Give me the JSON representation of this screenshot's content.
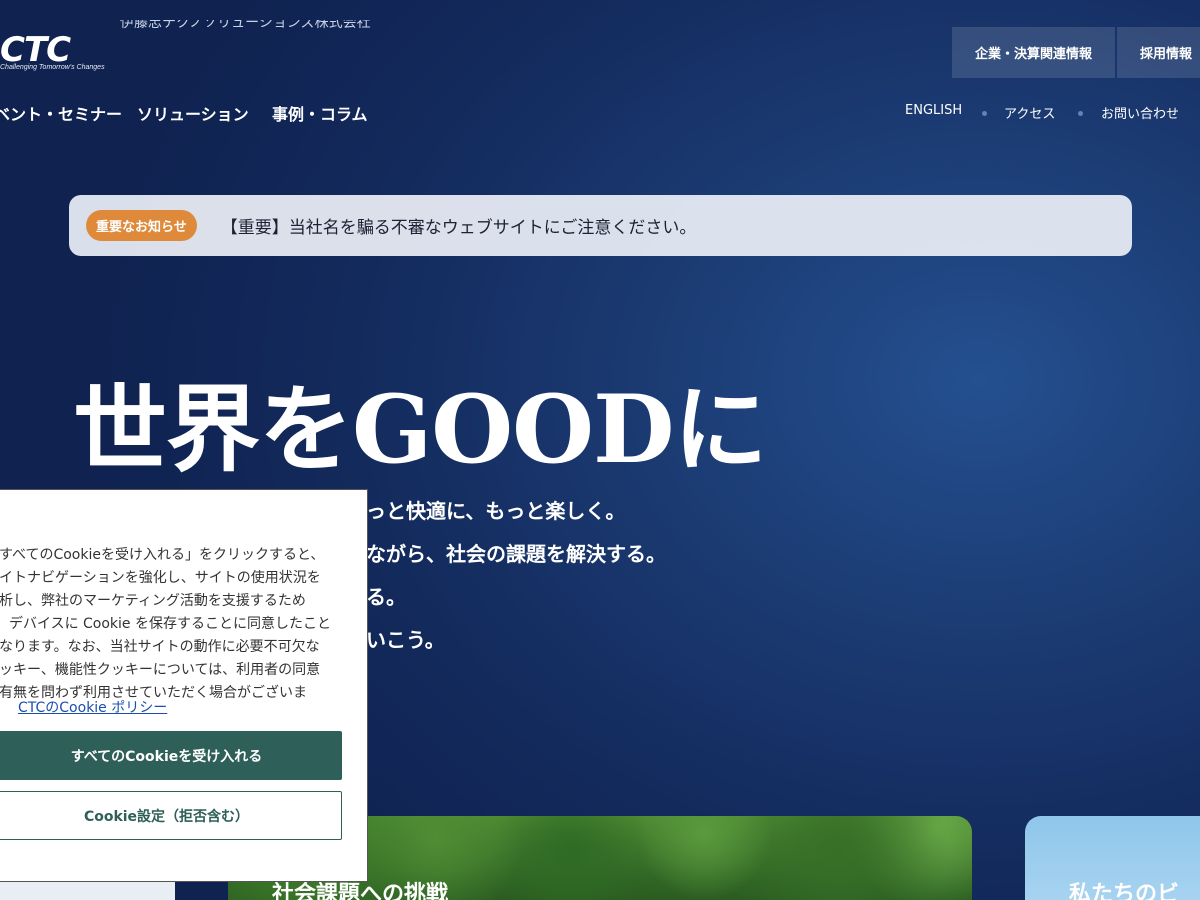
{
  "brand": {
    "logo_text": "CTC",
    "tagline": "Challenging Tomorrow's Changes",
    "company_name": "伊藤忠テクノソリューションズ株式会社"
  },
  "top_buttons": {
    "corporate": "企業・決算関連情報",
    "recruit": "採用情報"
  },
  "main_nav": [
    "ベント・セミナー",
    "ソリューション",
    "事例・コラム"
  ],
  "util_nav": [
    "ENGLISH",
    "アクセス",
    "お問い合わせ"
  ],
  "notice": {
    "badge": "重要なお知らせ",
    "text": "【重要】当社名を騙る不審なウェブサイトにご注意ください。"
  },
  "hero": {
    "title": "世界をGOODに",
    "lines": [
      "っと快適に、もっと楽しく。",
      "ながら、社会の課題を解決する。",
      "る。",
      "いこう。"
    ]
  },
  "cards": {
    "forest_title": "社会課題への挑戦",
    "sky_title": "私たちのビ"
  },
  "cookie": {
    "lines": [
      "すべてのCookieを受け入れる」をクリックすると、",
      "イトナビゲーションを強化し、サイトの使用状況を",
      "析し、弊社のマーケティング活動を支援するため",
      "デバイスに Cookie を保存することに同意したこと",
      "なります。なお、当社サイトの動作に必要不可欠な",
      "ッキー、機能性クッキーについては、利用者の同意",
      "有無を問わず利用させていただく場合がございま"
    ],
    "policy_link": "CTCのCookie ポリシー",
    "accept_label": "すべてのCookieを受け入れる",
    "settings_label": "Cookie設定（拒否含む）"
  },
  "colors": {
    "background": "#132a5c",
    "notice_badge": "#de8a3a",
    "cookie_primary": "#2e5f58",
    "link": "#1a4fb0"
  }
}
